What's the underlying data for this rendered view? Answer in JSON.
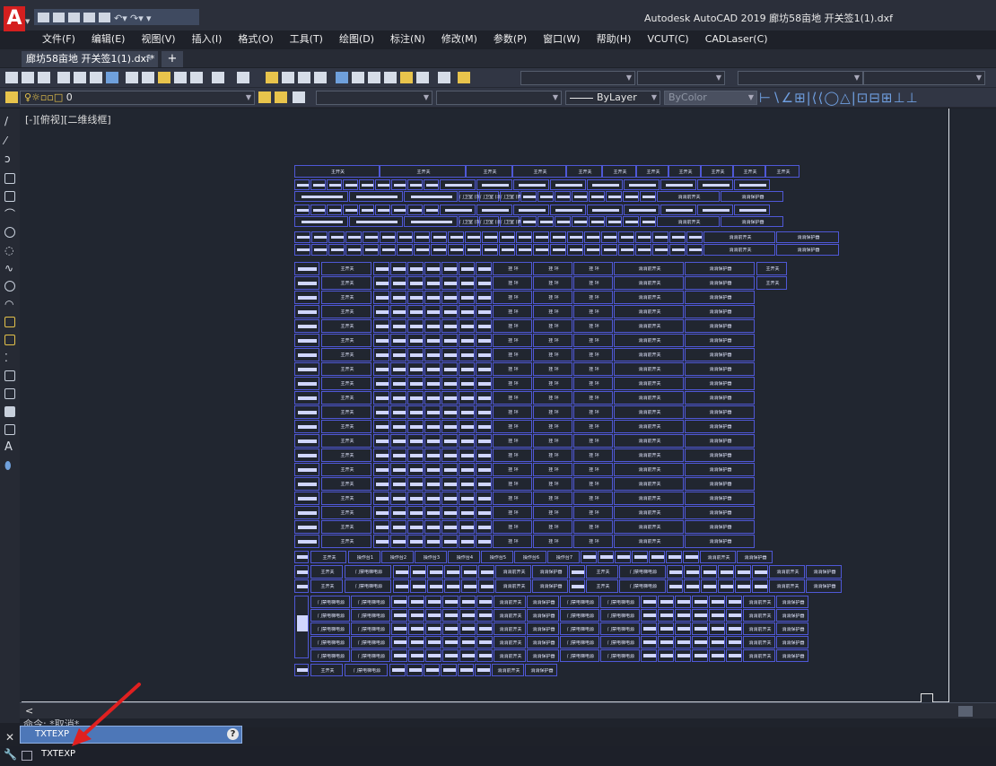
{
  "app": {
    "logo": "A",
    "title": "Autodesk AutoCAD 2019    廊坊58亩地 开关签1(1).dxf"
  },
  "menu": [
    "文件(F)",
    "编辑(E)",
    "视图(V)",
    "插入(I)",
    "格式(O)",
    "工具(T)",
    "绘图(D)",
    "标注(N)",
    "修改(M)",
    "参数(P)",
    "窗口(W)",
    "帮助(H)",
    "VCUT(C)",
    "CADLaser(C)"
  ],
  "file_tab": {
    "label": "廊坊58亩地 开关签1(1).dxf*",
    "close": "✕",
    "new": "+"
  },
  "toolbar": {
    "layer_value": "0",
    "linetype_value": "ByLayer",
    "color_value": "ByColor"
  },
  "viewport_label": "[-][俯视][二维线框]",
  "command": {
    "history": "命令: *取消*",
    "panel_title": "TXTEXP",
    "input": "TXTEXP"
  },
  "scroll_left_arrow": "<",
  "drawing_labels": {
    "main_switch": "主开关",
    "fire_switch": "消消前开关",
    "fire_protector": "消消保护器",
    "backup": "挂 坪",
    "door_power": "门禁电梯电源",
    "op1": "操作台1",
    "op2": "操作台2",
    "op3": "操作台3",
    "op4": "操作台4",
    "op5": "操作台5",
    "op6": "操作台6",
    "op7": "操作台7",
    "guard1": "门卫室\n(东侧)",
    "guard2": "门卫室\n(北侧)",
    "guard3": "门卫室\n(西侧)"
  },
  "colors": {
    "drawing_line": "#4f58d6",
    "logo": "#d41f1f",
    "arrow": "#e02020",
    "cmd_panel": "#4d77b8"
  }
}
